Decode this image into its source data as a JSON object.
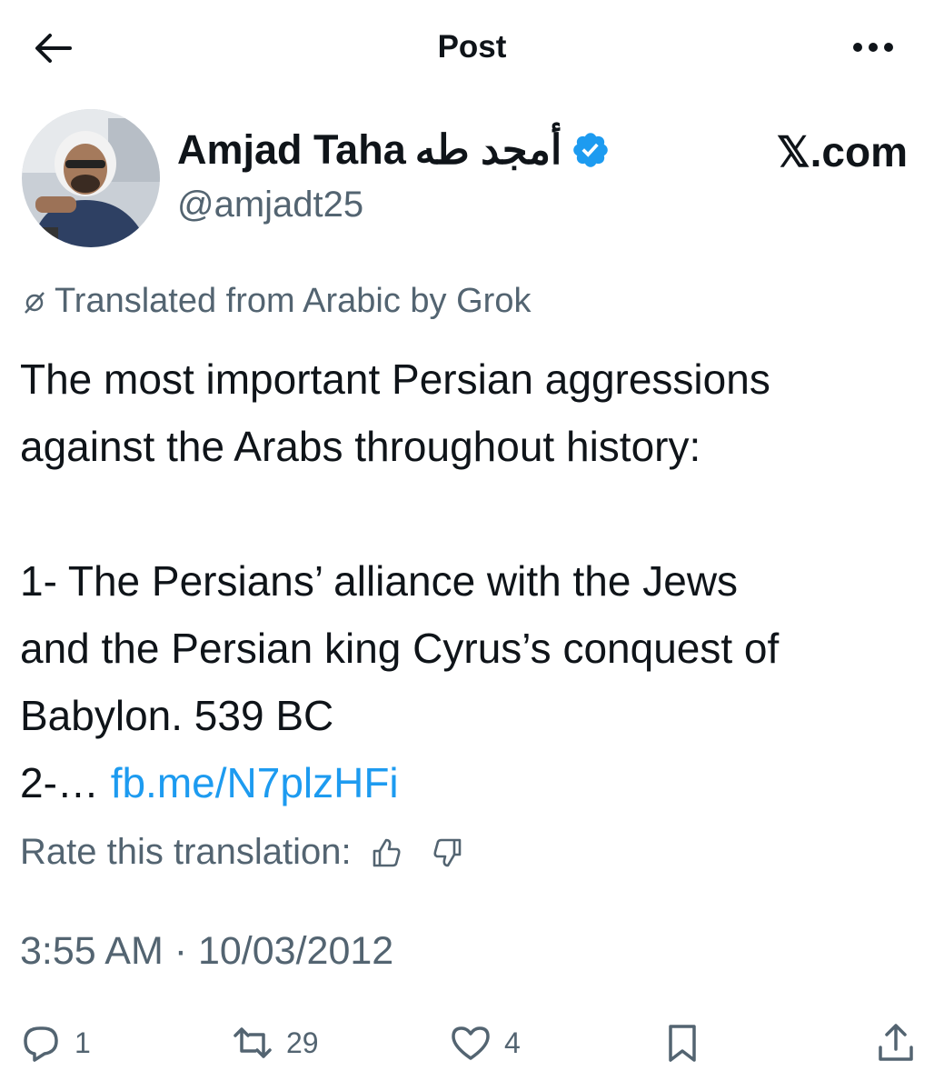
{
  "header": {
    "title": "Post",
    "back_icon": "arrow-left-icon",
    "more_icon": "more-horizontal-icon"
  },
  "author": {
    "name": "Amjad Taha",
    "name_arabic": "أمجد طه",
    "handle": "@amjadt25",
    "verified": true,
    "verified_color": "#1d9bf0"
  },
  "site_tag": "𝕏.com",
  "translation_note": "Translated from Arabic by Grok",
  "tweet": {
    "lines": [
      "The most important Persian aggressions",
      "against the Arabs throughout history:",
      "1- The Persians’ alliance with the Jews",
      "and the Persian king Cyrus’s conquest of",
      "Babylon. 539 BC"
    ],
    "truncated_prefix": "2-…",
    "link_text": "fb.me/N7plzHFi",
    "link_color": "#1d9bf0"
  },
  "rate": {
    "label": "Rate this translation:",
    "up_icon": "thumbs-up-icon",
    "down_icon": "thumbs-down-icon"
  },
  "timestamp": "3:55 AM · 10/03/2012",
  "actions": {
    "replies": "1",
    "reposts": "29",
    "likes": "4"
  },
  "colors": {
    "text": "#0f1419",
    "secondary": "#536471",
    "accent": "#1d9bf0"
  }
}
